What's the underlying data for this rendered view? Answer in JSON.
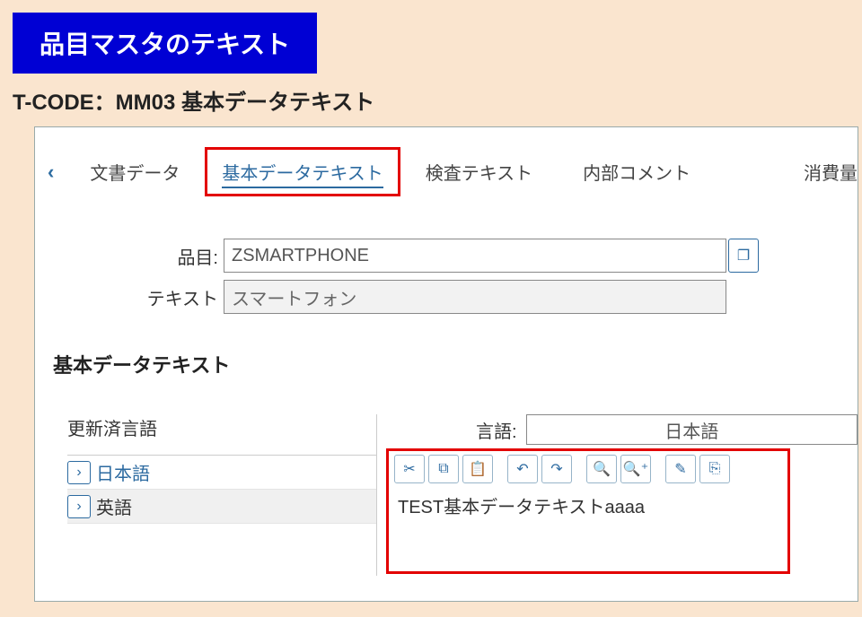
{
  "banner": "品目マスタのテキスト",
  "tcode": "T-CODE：MM03 基本データテキスト",
  "back_glyph": "‹",
  "tabs": {
    "t0": "文書データ",
    "t1": "基本データテキスト",
    "t2": "検査テキスト",
    "t3": "内部コメント",
    "t4": "消費量"
  },
  "form": {
    "item_label": "品目:",
    "item_value": "ZSMARTPHONE",
    "text_label": "テキスト",
    "text_value": "スマートフォン"
  },
  "section_title": "基本データテキスト",
  "lang": {
    "updated_header": "更新済言語",
    "lang_label": "言語:",
    "selected": "日本語",
    "row0": "日本語",
    "row1": "英語"
  },
  "editor": {
    "content": "TEST基本データテキストaaaa"
  },
  "icons": {
    "cut": "✂",
    "copy": "⧉",
    "paste": "📋",
    "undo": "↶",
    "redo": "↷",
    "find": "🔍",
    "findplus": "🔍⁺",
    "insert": "✎",
    "export": "⎘",
    "chev": "›",
    "valuehelp": "❐"
  }
}
